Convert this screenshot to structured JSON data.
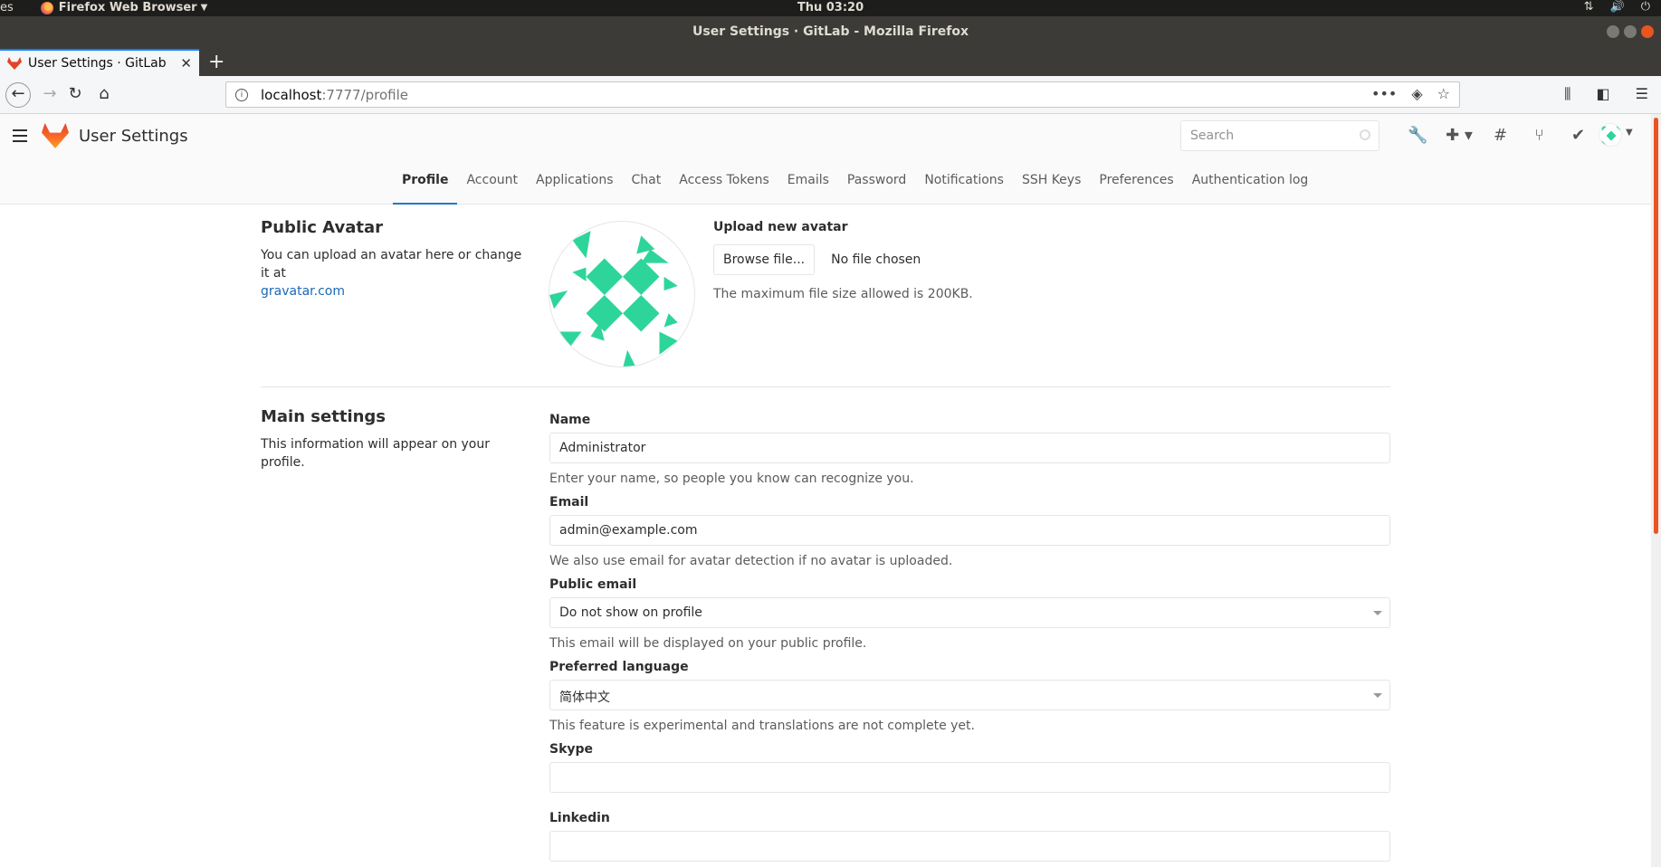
{
  "os": {
    "app_menu": "Firefox Web Browser",
    "left_fragment": "es",
    "clock": "Thu 03:20"
  },
  "window": {
    "title": "User Settings · GitLab - Mozilla Firefox"
  },
  "browser": {
    "tab_title": "User Settings · GitLab",
    "url_host": "localhost",
    "url_path": ":7777/profile"
  },
  "header": {
    "page_title": "User Settings",
    "search_placeholder": "Search"
  },
  "subnav": {
    "tabs": [
      {
        "label": "Profile",
        "active": true
      },
      {
        "label": "Account"
      },
      {
        "label": "Applications"
      },
      {
        "label": "Chat"
      },
      {
        "label": "Access Tokens"
      },
      {
        "label": "Emails"
      },
      {
        "label": "Password"
      },
      {
        "label": "Notifications"
      },
      {
        "label": "SSH Keys"
      },
      {
        "label": "Preferences"
      },
      {
        "label": "Authentication log"
      }
    ]
  },
  "avatar_section": {
    "title": "Public Avatar",
    "description": "You can upload an avatar here or change it at",
    "link": "gravatar.com",
    "upload_title": "Upload new avatar",
    "browse_label": "Browse file...",
    "file_status": "No file chosen",
    "size_hint": "The maximum file size allowed is 200KB.",
    "identicon_color": "#2ed59a"
  },
  "main_settings": {
    "title": "Main settings",
    "description": "This information will appear on your profile.",
    "fields": {
      "name": {
        "label": "Name",
        "value": "Administrator",
        "help": "Enter your name, so people you know can recognize you."
      },
      "email": {
        "label": "Email",
        "value": "admin@example.com",
        "help": "We also use email for avatar detection if no avatar is uploaded."
      },
      "public_email": {
        "label": "Public email",
        "value": "Do not show on profile",
        "help": "This email will be displayed on your public profile."
      },
      "language": {
        "label": "Preferred language",
        "value": "简体中文",
        "help": "This feature is experimental and translations are not complete yet."
      },
      "skype": {
        "label": "Skype",
        "value": ""
      },
      "linkedin": {
        "label": "Linkedin",
        "value": ""
      }
    }
  },
  "colors": {
    "accent": "#1f78d1",
    "gitlab_orange": "#e24329",
    "ubuntu_orange": "#e95420"
  }
}
